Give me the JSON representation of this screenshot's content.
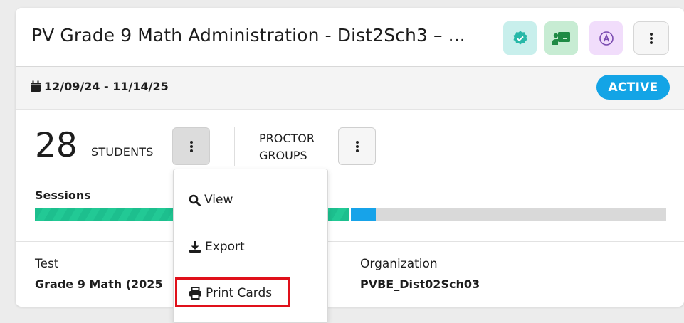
{
  "header": {
    "title": "PV Grade 9 Math Administration - Dist2Sch3 – ...",
    "icons": [
      "shield-check-icon",
      "teacher-board-icon",
      "accommodation-a-icon",
      "more-vertical-icon"
    ]
  },
  "dates": {
    "range": "12/09/24 - 11/14/25",
    "status": "ACTIVE",
    "status_color": "#13a4e6"
  },
  "students": {
    "count": "28",
    "label": "STUDENTS"
  },
  "proctor": {
    "label": "PROCTOR GROUPS"
  },
  "sessions": {
    "label": "Sessions",
    "progress": {
      "completed_fraction": 0.498,
      "in_progress_fraction": 0.04,
      "completed_color": "#1dbf8e",
      "in_progress_color": "#17a3e9"
    }
  },
  "test": {
    "label": "Test",
    "value": "Grade 9 Math (2025"
  },
  "organization": {
    "label": "Organization",
    "value": "PVBE_Dist02Sch03"
  },
  "menu": {
    "items": [
      {
        "label": "View",
        "icon": "search-icon"
      },
      {
        "label": "Export",
        "icon": "download-icon"
      },
      {
        "label": "Print Cards",
        "icon": "print-icon"
      }
    ]
  }
}
